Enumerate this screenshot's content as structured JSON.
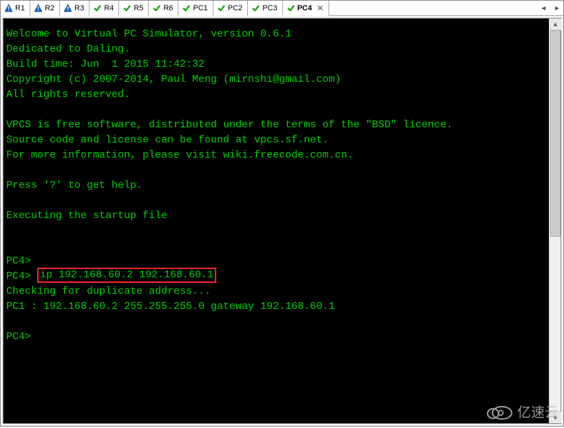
{
  "tabs": [
    {
      "label": "R1",
      "icon": "warn"
    },
    {
      "label": "R2",
      "icon": "warn"
    },
    {
      "label": "R3",
      "icon": "warn"
    },
    {
      "label": "R4",
      "icon": "check"
    },
    {
      "label": "R5",
      "icon": "check"
    },
    {
      "label": "R6",
      "icon": "check"
    },
    {
      "label": "PC1",
      "icon": "check"
    },
    {
      "label": "PC2",
      "icon": "check"
    },
    {
      "label": "PC3",
      "icon": "check"
    },
    {
      "label": "PC4",
      "icon": "check",
      "active": true
    }
  ],
  "terminal": {
    "lines_before": "Welcome to Virtual PC Simulator, version 0.6.1\nDedicated to Daling.\nBuild time: Jun  1 2015 11:42:32\nCopyright (c) 2007-2014, Paul Meng (mirnshi@gmail.com)\nAll rights reserved.\n\nVPCS is free software, distributed under the terms of the \"BSD\" licence.\nSource code and license can be found at vpcs.sf.net.\nFor more information, please visit wiki.freecode.com.cn.\n\nPress '?' to get help.\n\nExecuting the startup file\n\n\nPC4>",
    "prompt_cmd_prefix": "PC4> ",
    "highlighted_cmd": "ip 192.168.60.2 192.168.60.1",
    "lines_after": "Checking for duplicate address...\nPC1 : 192.168.60.2 255.255.255.0 gateway 192.168.60.1\n\nPC4>"
  },
  "watermark": {
    "text": "亿速云"
  }
}
